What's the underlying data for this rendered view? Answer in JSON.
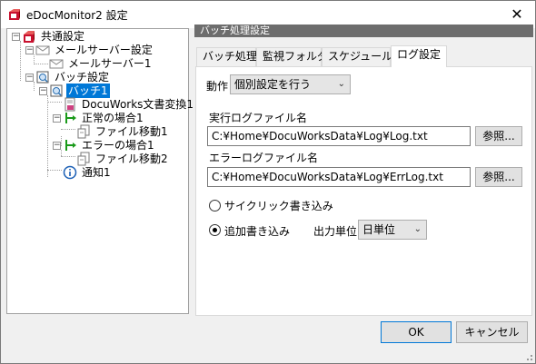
{
  "window": {
    "title": "eDocMonitor2 設定",
    "close_glyph": "✕"
  },
  "tree": {
    "items": [
      {
        "label": "共通設定",
        "icon": "gear-box-icon",
        "expander": "−"
      },
      {
        "label": "メールサーバー設定",
        "icon": "mail-icon",
        "expander": "−"
      },
      {
        "label": "メールサーバー1",
        "icon": "mail-icon"
      },
      {
        "label": "バッチ設定",
        "icon": "batch-icon",
        "expander": "−"
      },
      {
        "label": "バッチ1",
        "icon": "batch-icon",
        "expander": "−",
        "selected": true
      },
      {
        "label": "DocuWorks文書変換1",
        "icon": "docuworks-icon"
      },
      {
        "label": "正常の場合1",
        "icon": "green-branch-icon",
        "expander": "−"
      },
      {
        "label": "ファイル移動1",
        "icon": "file-move-icon"
      },
      {
        "label": "エラーの場合1",
        "icon": "green-branch-icon",
        "expander": "−"
      },
      {
        "label": "ファイル移動2",
        "icon": "file-move-icon"
      },
      {
        "label": "通知1",
        "icon": "info-icon"
      }
    ]
  },
  "panel": {
    "header": "バッチ処理設定",
    "tabs": [
      {
        "label": "バッチ処理"
      },
      {
        "label": "監視フォルダ"
      },
      {
        "label": "スケジュール"
      },
      {
        "label": "ログ設定",
        "active": true
      }
    ],
    "action_label": "動作",
    "action_value": "個別設定を行う",
    "exec_log_label": "実行ログファイル名",
    "exec_log_value": "C:¥Home¥DocuWorksData¥Log¥Log.txt",
    "browse_label": "参照...",
    "error_log_label": "エラーログファイル名",
    "error_log_value": "C:¥Home¥DocuWorksData¥Log¥ErrLog.txt",
    "radio_cyclic": "サイクリック書き込み",
    "radio_append": "追加書き込み",
    "output_unit_label": "出力単位",
    "output_unit_value": "日単位"
  },
  "footer": {
    "ok": "OK",
    "cancel": "キャンセル"
  },
  "colors": {
    "selection": "#0078d7",
    "header": "#6d6d6d"
  }
}
